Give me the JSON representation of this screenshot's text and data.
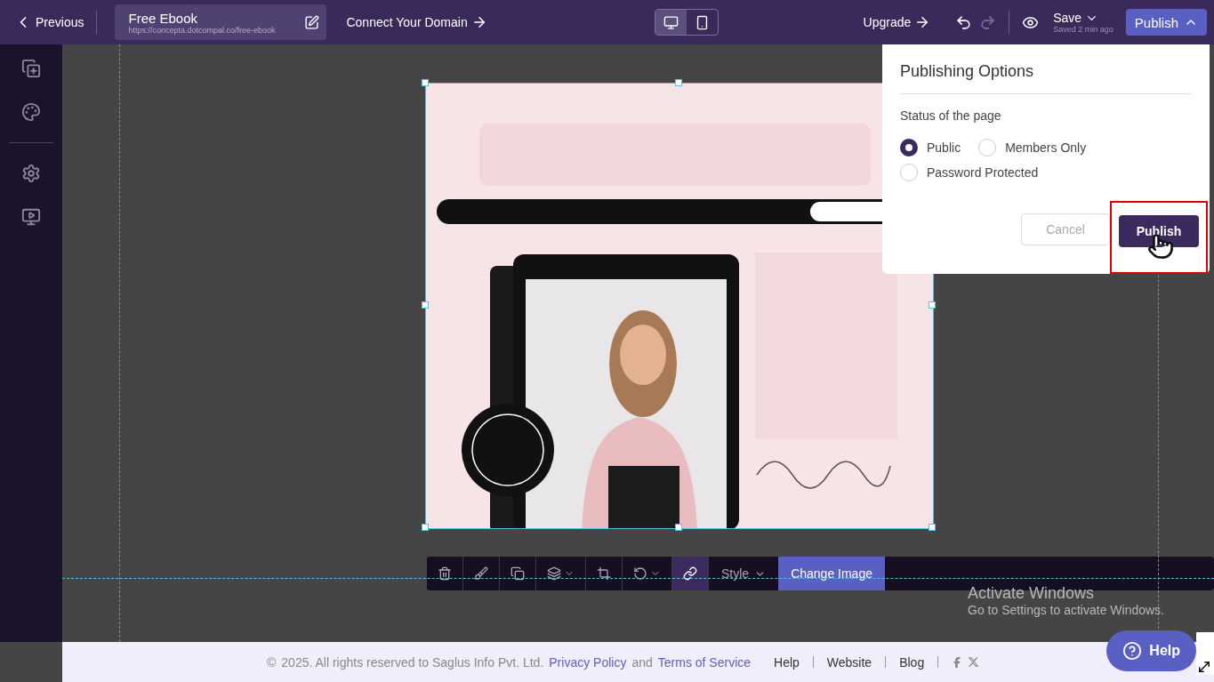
{
  "topbar": {
    "back": "Previous",
    "page_title": "Free Ebook",
    "page_url": "https://concepta.dotcompal.co/free-ebook",
    "domain_link": "Connect Your Domain",
    "devices": [
      {
        "kind": "desktop",
        "selected": true
      },
      {
        "kind": "mobile",
        "selected": false
      }
    ],
    "upgrade": "Upgrade",
    "redo_disabled": true,
    "save": "Save",
    "saved_status": "Saved 2 min ago",
    "publish": "Publish"
  },
  "sidebar": {
    "items": [
      {
        "kind": "add-page"
      },
      {
        "kind": "theme"
      },
      {
        "kind": "settings"
      },
      {
        "kind": "preview"
      }
    ]
  },
  "canvas": {
    "toolbar": {
      "tools": [
        {
          "kind": "delete",
          "selected": false
        },
        {
          "kind": "edit",
          "selected": false
        },
        {
          "kind": "duplicate",
          "selected": false
        },
        {
          "kind": "layers",
          "selected": false
        },
        {
          "kind": "crop",
          "selected": false
        },
        {
          "kind": "rotate",
          "selected": false
        },
        {
          "kind": "link",
          "selected": true
        }
      ],
      "style": "Style",
      "change_image": "Change Image"
    }
  },
  "publishing_options": {
    "title": "Publishing Options",
    "status_label": "Status of the page",
    "options": [
      {
        "label": "Public",
        "selected": true
      },
      {
        "label": "Members Only",
        "selected": false
      },
      {
        "label": "Password Protected",
        "selected": false
      }
    ],
    "cancel": "Cancel",
    "publish": "Publish",
    "highlighted": true
  },
  "footer": {
    "copyright_symbol": "©",
    "copyright": "2025. All rights reserved to Saglus Info Pvt. Ltd.",
    "privacy": "Privacy Policy",
    "and": "and",
    "terms": "Terms of Service",
    "links": [
      "Help",
      "Website",
      "Blog"
    ]
  },
  "help_button": "Help",
  "os_notice": {
    "title": "Activate Windows",
    "text": "Go to Settings to activate Windows."
  }
}
